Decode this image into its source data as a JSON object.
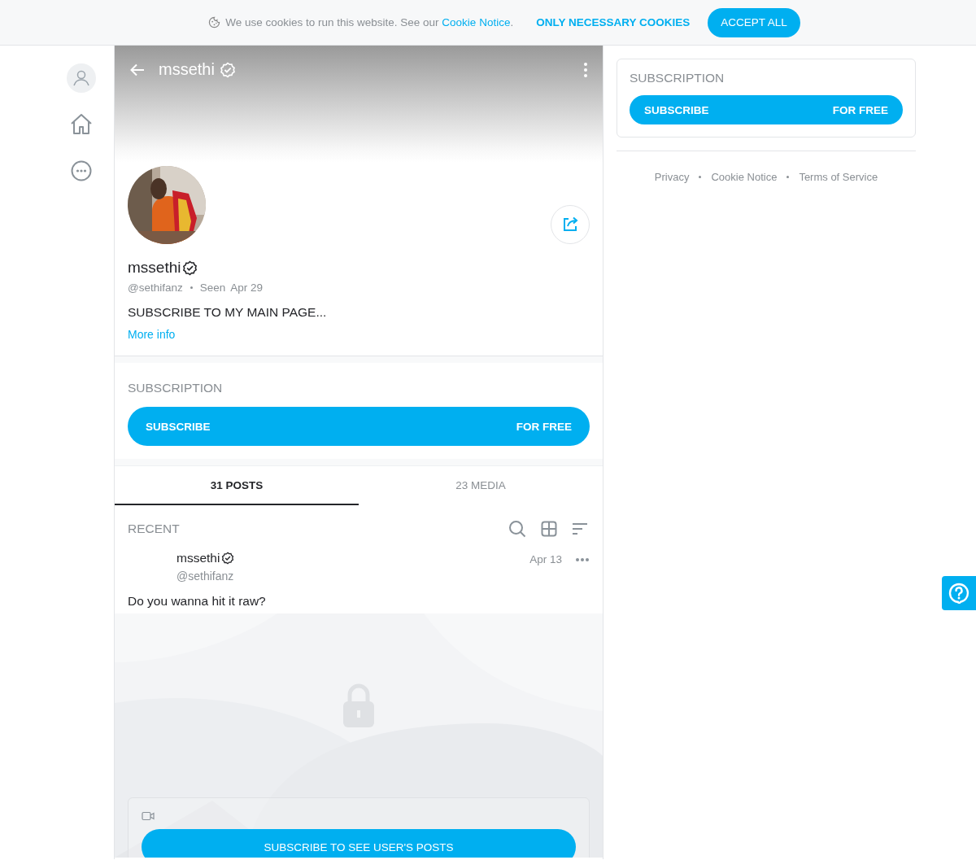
{
  "cookie_bar": {
    "text": "We use cookies to run this website. See our ",
    "link": "Cookie Notice",
    "end": ".",
    "buttons": [
      {
        "label": "ONLY NECESSARY COOKIES",
        "kind": "text"
      },
      {
        "label": "ACCEPT ALL",
        "kind": "filled"
      }
    ]
  },
  "sidebar": {
    "items": [
      {
        "kind": "avatar"
      },
      {
        "kind": "home"
      },
      {
        "kind": "more"
      }
    ]
  },
  "header": {
    "title": "mssethi",
    "verified": true
  },
  "profile": {
    "name": "mssethi",
    "verified": true,
    "handle": "@sethifanz",
    "seen_label": "Seen",
    "seen_date": "Apr 29",
    "bio": "SUBSCRIBE TO MY MAIN PAGE...",
    "more_info": "More info"
  },
  "subscription": {
    "heading": "SUBSCRIPTION",
    "button": "SUBSCRIBE",
    "price": "FOR FREE"
  },
  "tabs": [
    {
      "label": "31 POSTS",
      "selected": true
    },
    {
      "label": "23 MEDIA",
      "selected": false
    }
  ],
  "feed": {
    "heading": "RECENT",
    "post": {
      "author": "mssethi",
      "verified": true,
      "handle": "@sethifanz",
      "date": "Apr 13",
      "text": "Do you wanna hit it raw?",
      "media": {
        "kind": "video",
        "locked": true
      },
      "button": "SUBSCRIBE TO SEE USER'S POSTS"
    }
  },
  "right_panel": {
    "subscription": {
      "heading": "SUBSCRIPTION",
      "button": "SUBSCRIBE",
      "price": "FOR FREE"
    },
    "footer_links": [
      "Privacy",
      "Cookie Notice",
      "Terms of Service"
    ]
  }
}
